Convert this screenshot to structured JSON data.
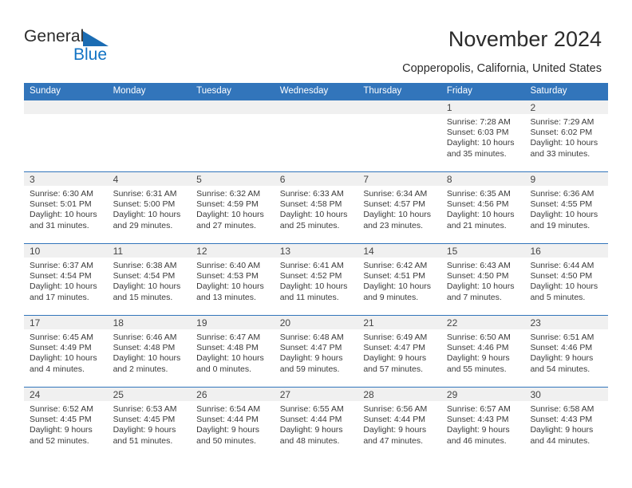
{
  "brand": {
    "name_part1": "General",
    "name_part2": "Blue",
    "accent_color": "#1273c4",
    "triangle_color": "#1b6cb3"
  },
  "header": {
    "title": "November 2024",
    "subtitle": "Copperopolis, California, United States"
  },
  "calendar": {
    "header_bg": "#3275bb",
    "weekdays": [
      "Sunday",
      "Monday",
      "Tuesday",
      "Wednesday",
      "Thursday",
      "Friday",
      "Saturday"
    ],
    "weeks": [
      [
        {
          "day": "",
          "empty": true
        },
        {
          "day": "",
          "empty": true
        },
        {
          "day": "",
          "empty": true
        },
        {
          "day": "",
          "empty": true
        },
        {
          "day": "",
          "empty": true
        },
        {
          "day": "1",
          "sunrise": "Sunrise: 7:28 AM",
          "sunset": "Sunset: 6:03 PM",
          "daylight1": "Daylight: 10 hours",
          "daylight2": "and 35 minutes."
        },
        {
          "day": "2",
          "sunrise": "Sunrise: 7:29 AM",
          "sunset": "Sunset: 6:02 PM",
          "daylight1": "Daylight: 10 hours",
          "daylight2": "and 33 minutes."
        }
      ],
      [
        {
          "day": "3",
          "sunrise": "Sunrise: 6:30 AM",
          "sunset": "Sunset: 5:01 PM",
          "daylight1": "Daylight: 10 hours",
          "daylight2": "and 31 minutes."
        },
        {
          "day": "4",
          "sunrise": "Sunrise: 6:31 AM",
          "sunset": "Sunset: 5:00 PM",
          "daylight1": "Daylight: 10 hours",
          "daylight2": "and 29 minutes."
        },
        {
          "day": "5",
          "sunrise": "Sunrise: 6:32 AM",
          "sunset": "Sunset: 4:59 PM",
          "daylight1": "Daylight: 10 hours",
          "daylight2": "and 27 minutes."
        },
        {
          "day": "6",
          "sunrise": "Sunrise: 6:33 AM",
          "sunset": "Sunset: 4:58 PM",
          "daylight1": "Daylight: 10 hours",
          "daylight2": "and 25 minutes."
        },
        {
          "day": "7",
          "sunrise": "Sunrise: 6:34 AM",
          "sunset": "Sunset: 4:57 PM",
          "daylight1": "Daylight: 10 hours",
          "daylight2": "and 23 minutes."
        },
        {
          "day": "8",
          "sunrise": "Sunrise: 6:35 AM",
          "sunset": "Sunset: 4:56 PM",
          "daylight1": "Daylight: 10 hours",
          "daylight2": "and 21 minutes."
        },
        {
          "day": "9",
          "sunrise": "Sunrise: 6:36 AM",
          "sunset": "Sunset: 4:55 PM",
          "daylight1": "Daylight: 10 hours",
          "daylight2": "and 19 minutes."
        }
      ],
      [
        {
          "day": "10",
          "sunrise": "Sunrise: 6:37 AM",
          "sunset": "Sunset: 4:54 PM",
          "daylight1": "Daylight: 10 hours",
          "daylight2": "and 17 minutes."
        },
        {
          "day": "11",
          "sunrise": "Sunrise: 6:38 AM",
          "sunset": "Sunset: 4:54 PM",
          "daylight1": "Daylight: 10 hours",
          "daylight2": "and 15 minutes."
        },
        {
          "day": "12",
          "sunrise": "Sunrise: 6:40 AM",
          "sunset": "Sunset: 4:53 PM",
          "daylight1": "Daylight: 10 hours",
          "daylight2": "and 13 minutes."
        },
        {
          "day": "13",
          "sunrise": "Sunrise: 6:41 AM",
          "sunset": "Sunset: 4:52 PM",
          "daylight1": "Daylight: 10 hours",
          "daylight2": "and 11 minutes."
        },
        {
          "day": "14",
          "sunrise": "Sunrise: 6:42 AM",
          "sunset": "Sunset: 4:51 PM",
          "daylight1": "Daylight: 10 hours",
          "daylight2": "and 9 minutes."
        },
        {
          "day": "15",
          "sunrise": "Sunrise: 6:43 AM",
          "sunset": "Sunset: 4:50 PM",
          "daylight1": "Daylight: 10 hours",
          "daylight2": "and 7 minutes."
        },
        {
          "day": "16",
          "sunrise": "Sunrise: 6:44 AM",
          "sunset": "Sunset: 4:50 PM",
          "daylight1": "Daylight: 10 hours",
          "daylight2": "and 5 minutes."
        }
      ],
      [
        {
          "day": "17",
          "sunrise": "Sunrise: 6:45 AM",
          "sunset": "Sunset: 4:49 PM",
          "daylight1": "Daylight: 10 hours",
          "daylight2": "and 4 minutes."
        },
        {
          "day": "18",
          "sunrise": "Sunrise: 6:46 AM",
          "sunset": "Sunset: 4:48 PM",
          "daylight1": "Daylight: 10 hours",
          "daylight2": "and 2 minutes."
        },
        {
          "day": "19",
          "sunrise": "Sunrise: 6:47 AM",
          "sunset": "Sunset: 4:48 PM",
          "daylight1": "Daylight: 10 hours",
          "daylight2": "and 0 minutes."
        },
        {
          "day": "20",
          "sunrise": "Sunrise: 6:48 AM",
          "sunset": "Sunset: 4:47 PM",
          "daylight1": "Daylight: 9 hours",
          "daylight2": "and 59 minutes."
        },
        {
          "day": "21",
          "sunrise": "Sunrise: 6:49 AM",
          "sunset": "Sunset: 4:47 PM",
          "daylight1": "Daylight: 9 hours",
          "daylight2": "and 57 minutes."
        },
        {
          "day": "22",
          "sunrise": "Sunrise: 6:50 AM",
          "sunset": "Sunset: 4:46 PM",
          "daylight1": "Daylight: 9 hours",
          "daylight2": "and 55 minutes."
        },
        {
          "day": "23",
          "sunrise": "Sunrise: 6:51 AM",
          "sunset": "Sunset: 4:46 PM",
          "daylight1": "Daylight: 9 hours",
          "daylight2": "and 54 minutes."
        }
      ],
      [
        {
          "day": "24",
          "sunrise": "Sunrise: 6:52 AM",
          "sunset": "Sunset: 4:45 PM",
          "daylight1": "Daylight: 9 hours",
          "daylight2": "and 52 minutes."
        },
        {
          "day": "25",
          "sunrise": "Sunrise: 6:53 AM",
          "sunset": "Sunset: 4:45 PM",
          "daylight1": "Daylight: 9 hours",
          "daylight2": "and 51 minutes."
        },
        {
          "day": "26",
          "sunrise": "Sunrise: 6:54 AM",
          "sunset": "Sunset: 4:44 PM",
          "daylight1": "Daylight: 9 hours",
          "daylight2": "and 50 minutes."
        },
        {
          "day": "27",
          "sunrise": "Sunrise: 6:55 AM",
          "sunset": "Sunset: 4:44 PM",
          "daylight1": "Daylight: 9 hours",
          "daylight2": "and 48 minutes."
        },
        {
          "day": "28",
          "sunrise": "Sunrise: 6:56 AM",
          "sunset": "Sunset: 4:44 PM",
          "daylight1": "Daylight: 9 hours",
          "daylight2": "and 47 minutes."
        },
        {
          "day": "29",
          "sunrise": "Sunrise: 6:57 AM",
          "sunset": "Sunset: 4:43 PM",
          "daylight1": "Daylight: 9 hours",
          "daylight2": "and 46 minutes."
        },
        {
          "day": "30",
          "sunrise": "Sunrise: 6:58 AM",
          "sunset": "Sunset: 4:43 PM",
          "daylight1": "Daylight: 9 hours",
          "daylight2": "and 44 minutes."
        }
      ]
    ]
  }
}
